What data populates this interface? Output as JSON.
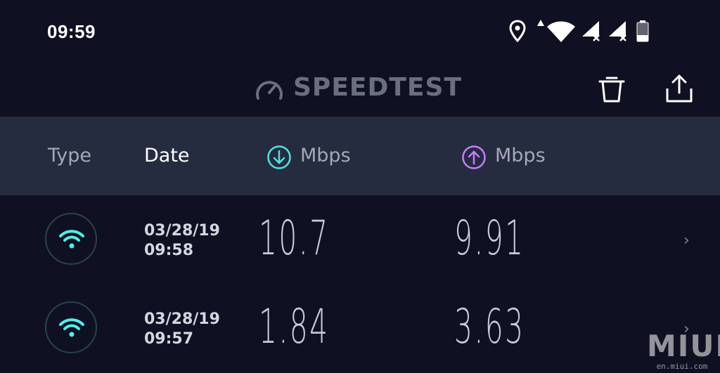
{
  "status_bar": {
    "time": "09:59",
    "icons": [
      "location-icon",
      "data-arrow-icon",
      "wifi-icon",
      "signal-no-sim-icon",
      "signal-no-sim-icon",
      "battery-icon"
    ]
  },
  "header": {
    "brand_icon": "speedometer-icon",
    "brand_text": "SPEEDTEST",
    "actions": [
      "trash-icon",
      "share-icon"
    ]
  },
  "columns": {
    "type": "Type",
    "date": "Date",
    "download": "Mbps",
    "upload": "Mbps",
    "download_icon": "download-arrow-icon",
    "upload_icon": "upload-arrow-icon"
  },
  "results": [
    {
      "type_icon": "wifi-icon",
      "date": "03/28/19",
      "time": "09:58",
      "download": "10.7",
      "upload": "9.91",
      "chevron": "›"
    },
    {
      "type_icon": "wifi-icon",
      "date": "03/28/19",
      "time": "09:57",
      "download": "1.84",
      "upload": "3.63",
      "chevron": "›"
    }
  ],
  "watermark": {
    "logo": "MIUI",
    "url": "en.miui.com"
  },
  "colors": {
    "background": "#0f1122",
    "header_band": "#262c40",
    "download_accent": "#4fe3e0",
    "upload_accent": "#c77dff",
    "wifi_accent": "#4ff0e8",
    "brand_gray": "#6a6f80"
  }
}
